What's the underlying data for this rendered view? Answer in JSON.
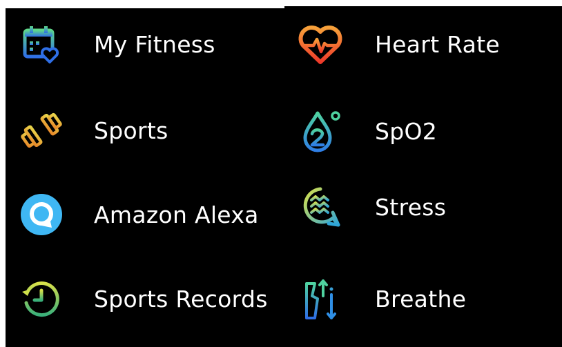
{
  "left_menu": {
    "items": [
      {
        "label": "My Fitness",
        "icon": "calendar-heart-icon"
      },
      {
        "label": "Sports",
        "icon": "dumbbell-icon"
      },
      {
        "label": "Amazon Alexa",
        "icon": "alexa-icon"
      },
      {
        "label": "Sports Records",
        "icon": "history-clock-icon"
      }
    ]
  },
  "right_menu": {
    "items": [
      {
        "label": "Heart Rate",
        "icon": "heart-pulse-icon"
      },
      {
        "label": "SpO2",
        "icon": "oxygen-drop-icon"
      },
      {
        "label": "Stress",
        "icon": "stress-waves-icon"
      },
      {
        "label": "Breathe",
        "icon": "breathe-icon"
      }
    ]
  },
  "colors": {
    "background": "#000000",
    "text": "#ffffff",
    "alexa_blue": "#3fb7f3",
    "heart_orange": "#f05a24",
    "accent_green": "#46c98a",
    "accent_yellow": "#e8c33a"
  }
}
